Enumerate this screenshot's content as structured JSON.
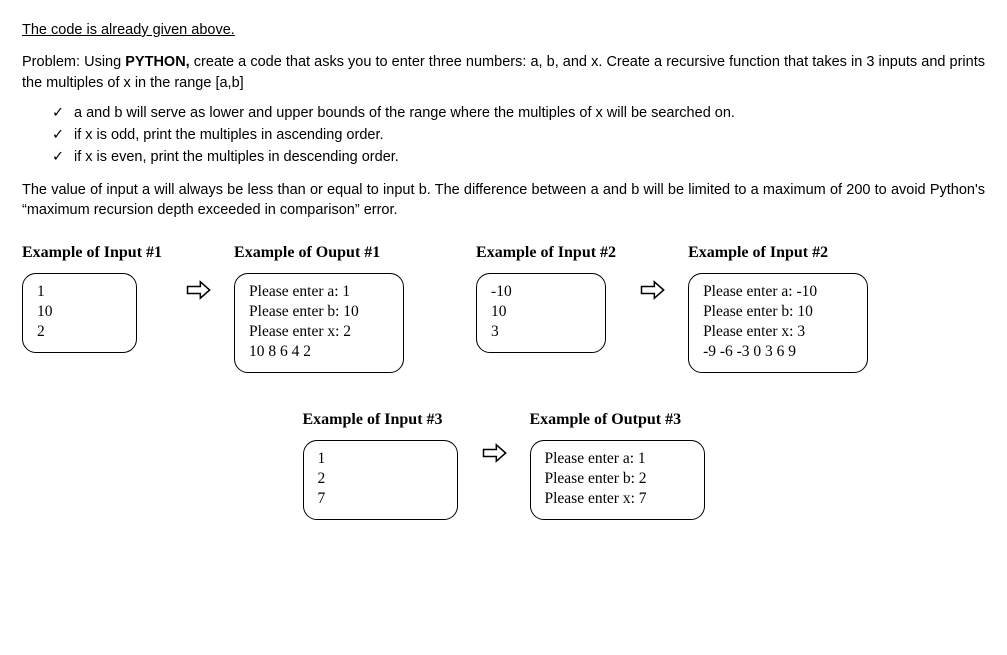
{
  "title": "The code is already given above.",
  "problem_prefix": "Problem: Using ",
  "problem_bold": "PYTHON,",
  "problem_rest": " create a code that asks you to enter three numbers: a, b, and x. Create a recursive function that takes in 3 inputs and prints the multiples of x in the range [a,b]",
  "bullets": [
    "a and b will serve as lower and upper bounds of the range where the multiples of x will be searched on.",
    "if x is odd, print the multiples in ascending order.",
    "if x is even, print the multiples in descending order."
  ],
  "note": "The value of input a will always be less than or equal to input b. The difference between a and b will be limited to a maximum of 200 to avoid Python's “maximum recursion depth exceeded in comparison” error.",
  "row1": {
    "ex1in": {
      "heading": "Example of Input #1",
      "lines": [
        "1",
        "10",
        "2"
      ]
    },
    "ex1out": {
      "heading": "Example of Ouput #1",
      "lines": [
        "Please enter a: 1",
        "Please enter b: 10",
        "Please enter x: 2",
        "10 8 6 4 2"
      ]
    },
    "ex2in": {
      "heading": "Example of Input #2",
      "lines": [
        "-10",
        "10",
        "3"
      ]
    },
    "ex2out": {
      "heading": "Example of Input #2",
      "lines": [
        "Please enter a: -10",
        "Please enter b: 10",
        "Please enter x: 3",
        "-9  -6  -3  0  3  6  9"
      ]
    }
  },
  "row2": {
    "ex3in": {
      "heading": "Example of Input #3",
      "lines": [
        "1",
        "2",
        "7"
      ]
    },
    "ex3out": {
      "heading": "Example of Output #3",
      "lines": [
        "Please enter a: 1",
        "Please enter b: 2",
        "Please enter x: 7"
      ]
    }
  },
  "checkmark": "✓"
}
